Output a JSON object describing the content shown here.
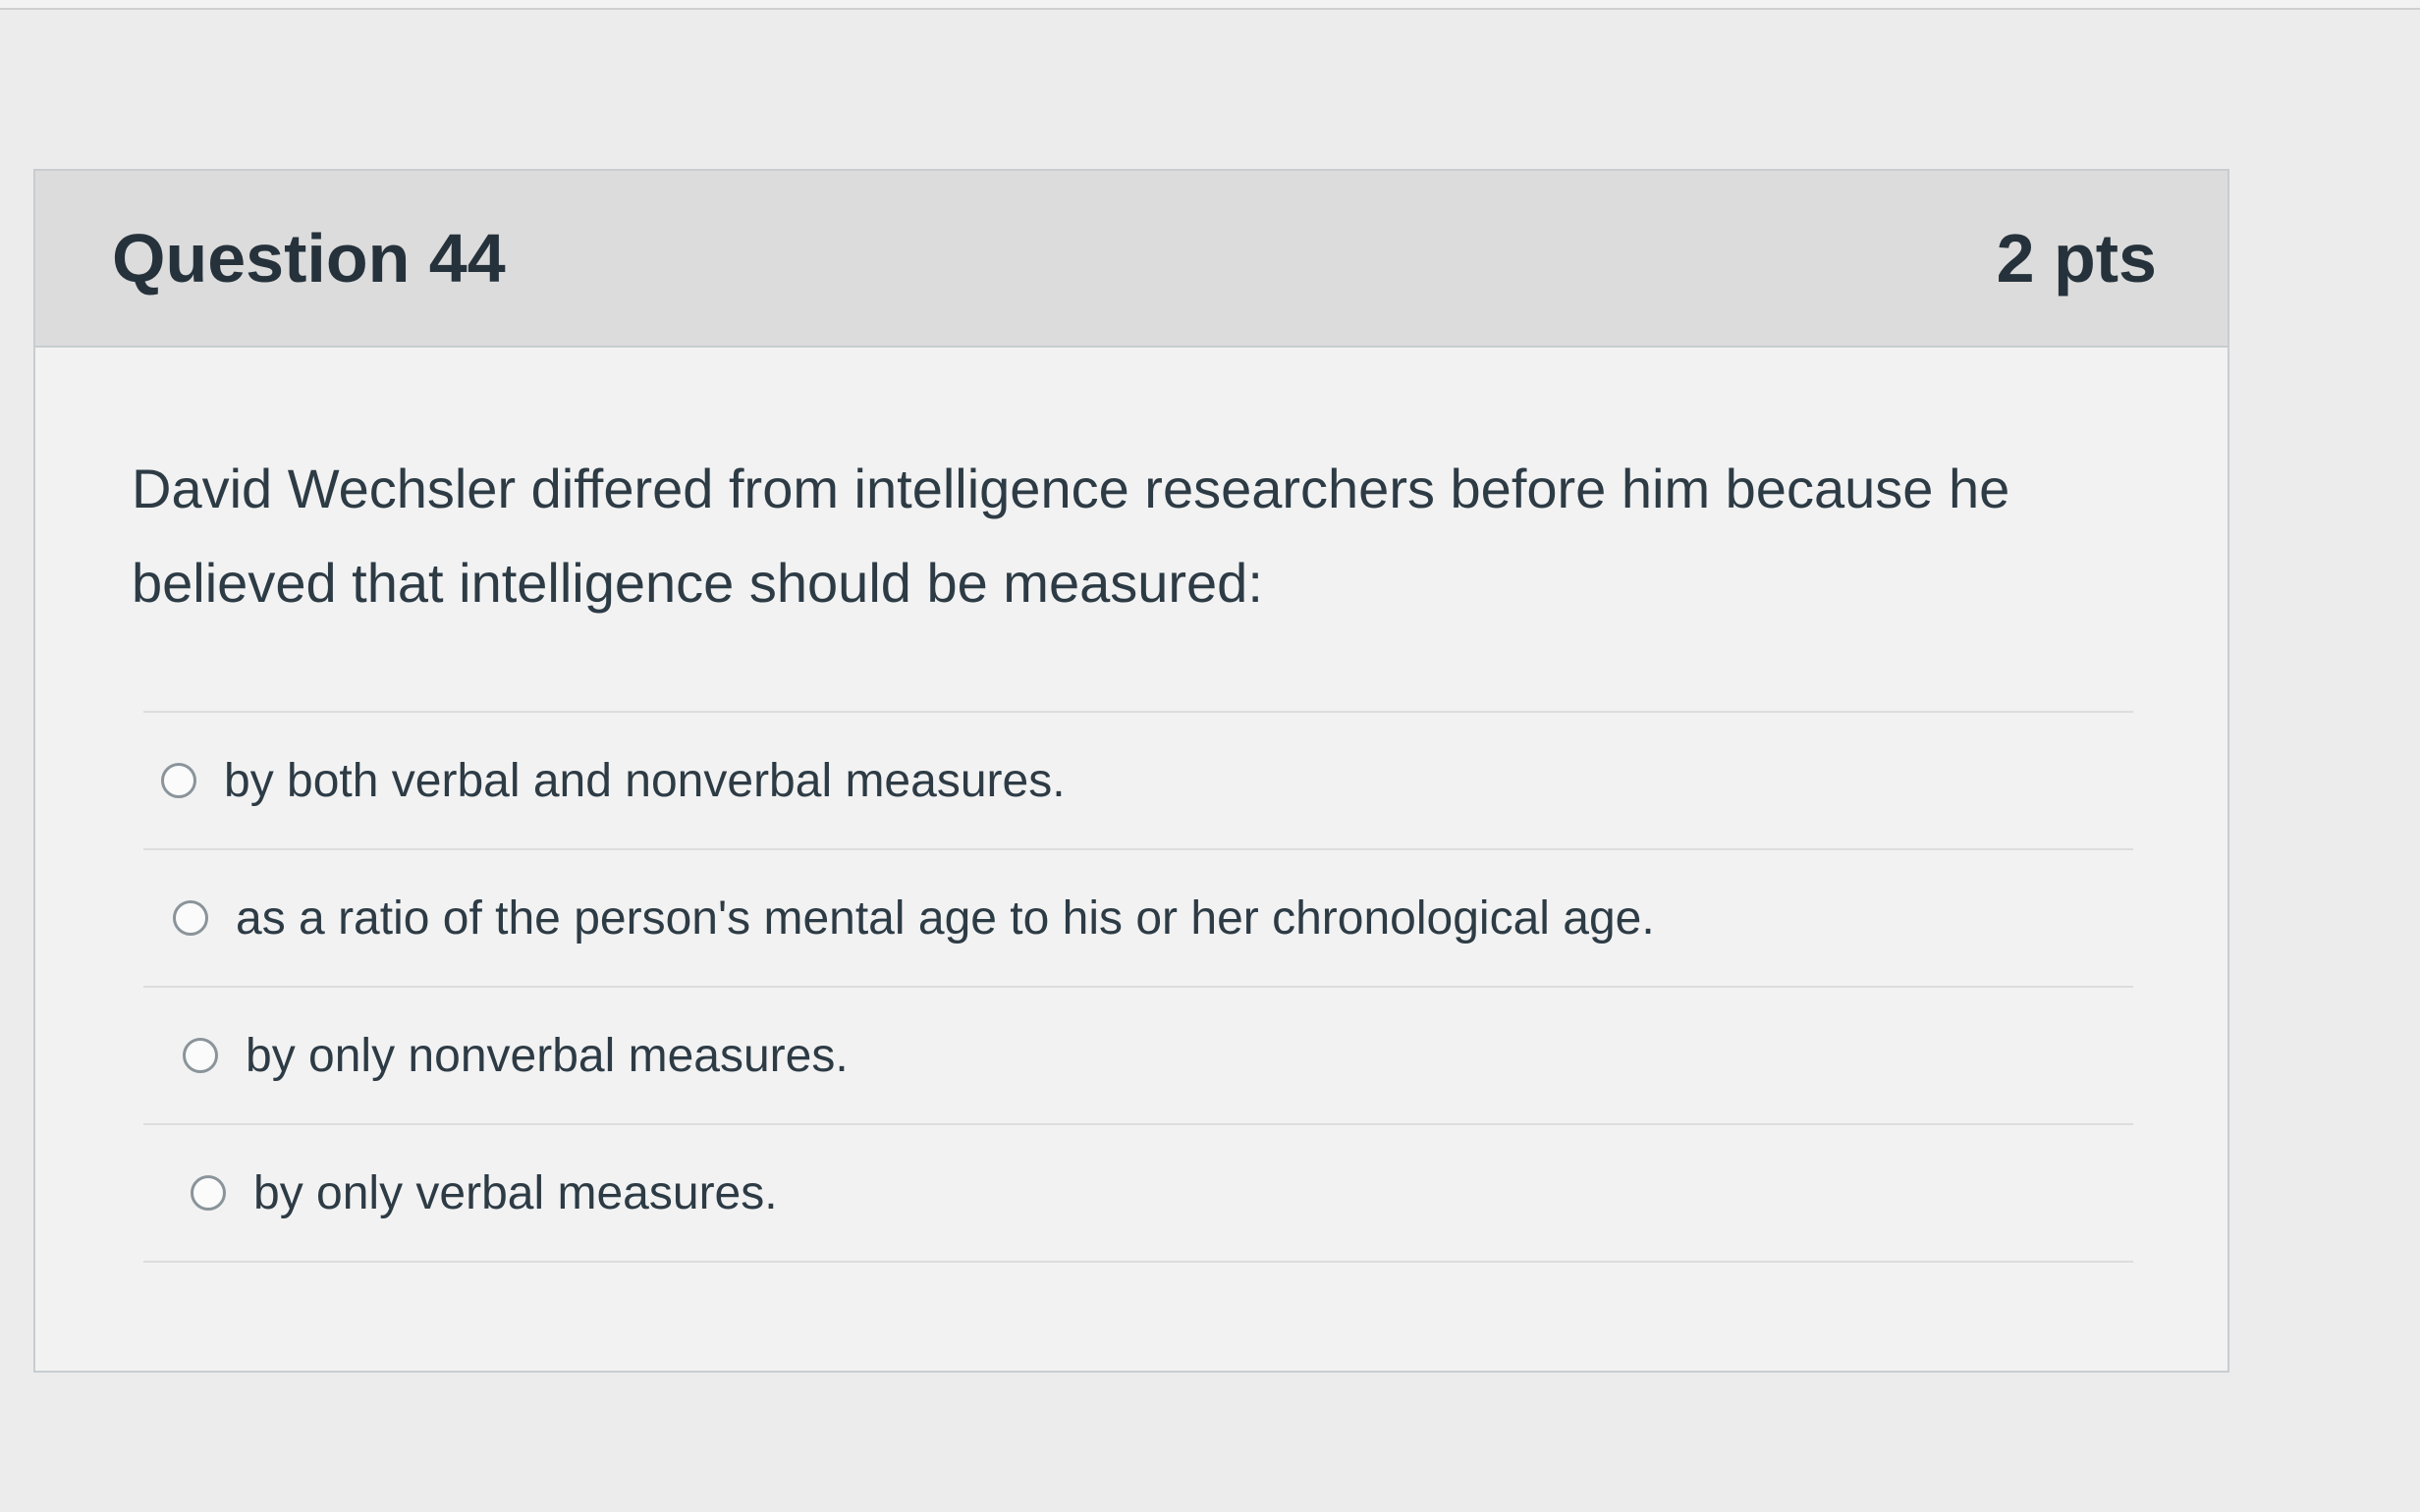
{
  "question": {
    "title": "Question 44",
    "points": "2 pts",
    "text": "David Wechsler differed from intelligence researchers before him because he believed that intelligence should be measured:",
    "answers": [
      {
        "label": "by both verbal and nonverbal measures."
      },
      {
        "label": "as a ratio of the person's mental age to his or her chronological age."
      },
      {
        "label": "by only nonverbal measures."
      },
      {
        "label": "by only verbal measures."
      }
    ]
  }
}
